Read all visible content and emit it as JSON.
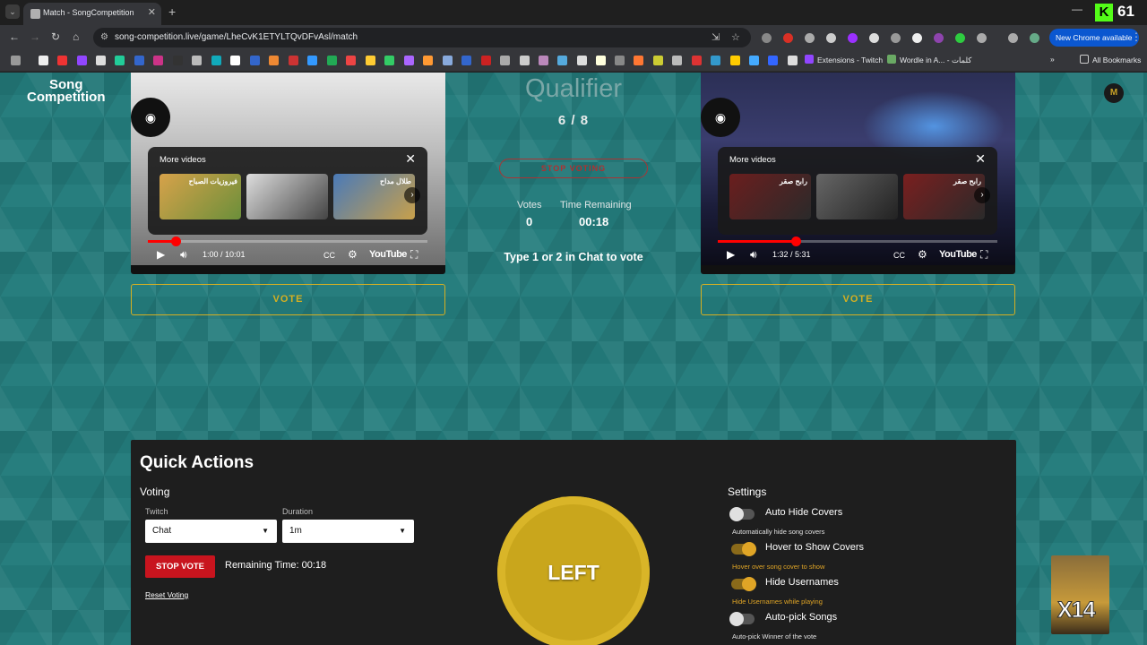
{
  "browser": {
    "tab_title": "Match - SongCompetition",
    "url": "song-competition.live/game/LheCvK1ETYLTQvDFvAsl/match",
    "new_chrome_label": "New Chrome available",
    "bookmarks_labeled": [
      "Extensions - Twitch",
      "Wordle in A... - كلمات"
    ],
    "all_bookmarks": "All Bookmarks",
    "overlay_count": "61"
  },
  "site": {
    "logo_line1": "Song",
    "logo_line2": "Competition"
  },
  "left_player": {
    "more_videos": "More videos",
    "thumb_labels": [
      "فيروزيات الصباح",
      "",
      "طلال مداح"
    ],
    "time": "1:00 / 10:01",
    "progress_fraction": 0.1,
    "youtube": "YouTube"
  },
  "right_player": {
    "more_videos": "More videos",
    "thumb_labels": [
      "رابح صقر",
      "",
      "رابح صقر"
    ],
    "time": "1:32 / 5:31",
    "progress_fraction": 0.28,
    "youtube": "YouTube"
  },
  "match": {
    "round": "Qualifier",
    "progress": "6 / 8",
    "stop_voting": "STOP VOTING",
    "votes_label": "Votes",
    "votes_value": "0",
    "time_label": "Time Remaining",
    "time_value": "00:18",
    "instruction": "Type 1 or 2 in Chat to vote",
    "vote_label": "VOTE"
  },
  "quick_actions": {
    "title": "Quick Actions",
    "voting_heading": "Voting",
    "twitch_label": "Twitch",
    "twitch_value": "Chat",
    "duration_label": "Duration",
    "duration_value": "1m",
    "stop_vote": "STOP VOTE",
    "remaining": "Remaining Time: 00:18",
    "reset": "Reset Voting",
    "big_button": "LEFT",
    "settings_heading": "Settings",
    "settings": [
      {
        "name": "Auto Hide Covers",
        "desc": "Automatically hide song covers",
        "on": false
      },
      {
        "name": "Hover to Show Covers",
        "desc": "Hover over song cover to show",
        "on": true
      },
      {
        "name": "Hide Usernames",
        "desc": "Hide Usernames while playing",
        "on": true
      },
      {
        "name": "Auto-pick Songs",
        "desc": "Auto-pick Winner of the vote",
        "on": false
      }
    ]
  },
  "overlay": {
    "multiplier": "X14"
  }
}
